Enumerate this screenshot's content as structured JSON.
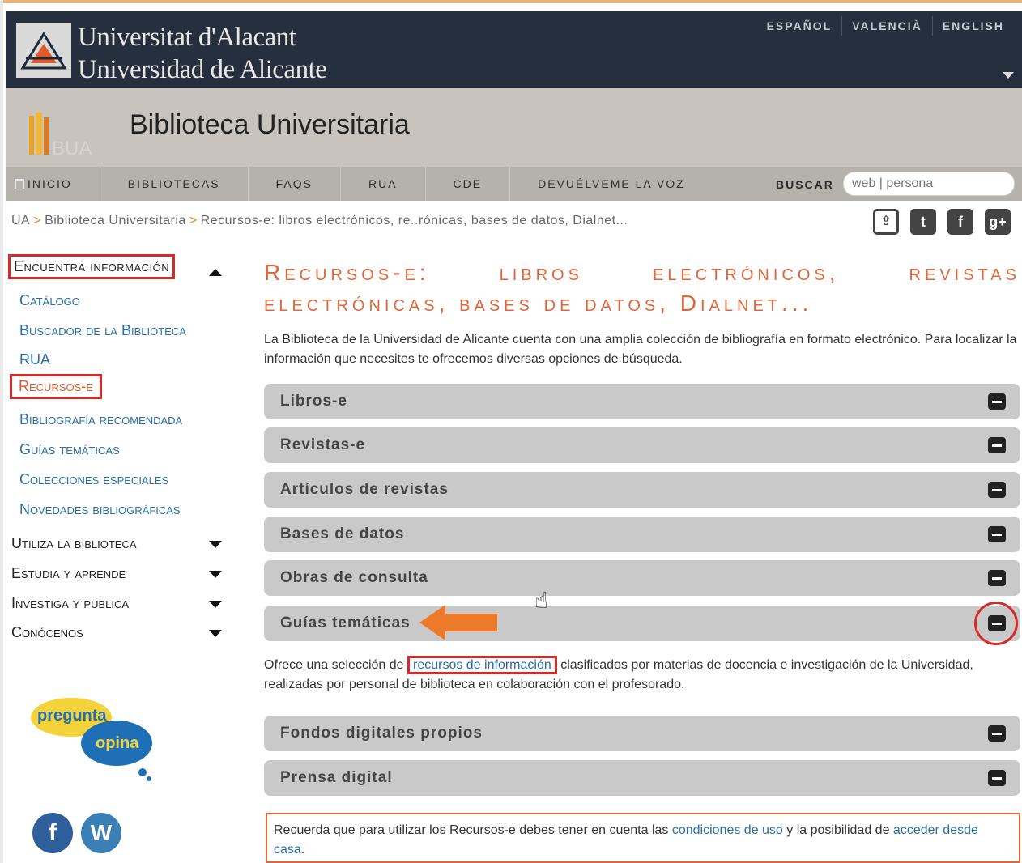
{
  "header": {
    "university_ca": "Universitat d'Alacant",
    "university_es": "Universidad de Alicante",
    "languages": [
      "ESPAÑOL",
      "VALENCIÀ",
      "ENGLISH"
    ]
  },
  "site": {
    "title": "Biblioteca Universitaria",
    "logo_text": "BUA"
  },
  "nav": {
    "items": [
      "INICIO",
      "BIBLIOTECAS",
      "FAQS",
      "RUA",
      "CDE",
      "DEVUÉLVEME LA VOZ"
    ],
    "search_label": "BUSCAR",
    "search_placeholder": "web | persona"
  },
  "breadcrumb": {
    "items": [
      "UA",
      "Biblioteca Universitaria",
      "Recursos-e: libros electrónicos, re..rónicas, bases de datos, Dialnet..."
    ]
  },
  "sidebar": {
    "section_open": "Encuentra información",
    "links": [
      "Catálogo",
      "Buscador de la Biblioteca",
      "RUA",
      "Recursos-e",
      "Bibliografía recomendada",
      "Guías temáticas",
      "Colecciones especiales",
      "Novedades bibliográficas"
    ],
    "sections": [
      "Utiliza la biblioteca",
      "Estudia y aprende",
      "Investiga y publica",
      "Conócenos"
    ],
    "pregunta": "pregunta",
    "opina": "opina"
  },
  "main": {
    "title_line1": [
      "Recursos-e:",
      "libros",
      "electrónicos,",
      "revistas"
    ],
    "title_line2": "electrónicas, bases de datos, Dialnet...",
    "intro": "La Biblioteca de la Universidad de Alicante cuenta con una amplia colección de bibliografía en formato electrónico. Para localizar la información que necesites te ofrecemos diversas opciones de búsqueda.",
    "accordion": [
      "Libros-e",
      "Revistas-e",
      "Artículos de revistas",
      "Bases de datos",
      "Obras de consulta",
      "Guías temáticas",
      "Fondos digitales propios",
      "Prensa digital"
    ],
    "guia_desc_before": "Ofrece una selección de ",
    "guia_desc_link": "recursos de información",
    "guia_desc_after": " clasificados por materias de docencia e investigación de la Universidad, realizadas por personal de biblioteca en colaboración con el profesorado.",
    "notice_before": "Recuerda que para utilizar los Recursos-e debes tener en cuenta las ",
    "notice_link1": "condiciones de uso",
    "notice_middle": " y la posibilidad de ",
    "notice_link2": "acceder desde casa",
    "notice_after": "."
  },
  "colors": {
    "header_bg": "#252f3d",
    "accent_orange": "#e0663a",
    "link_blue": "#2a6ea6",
    "highlight_red": "#d42a2a"
  }
}
